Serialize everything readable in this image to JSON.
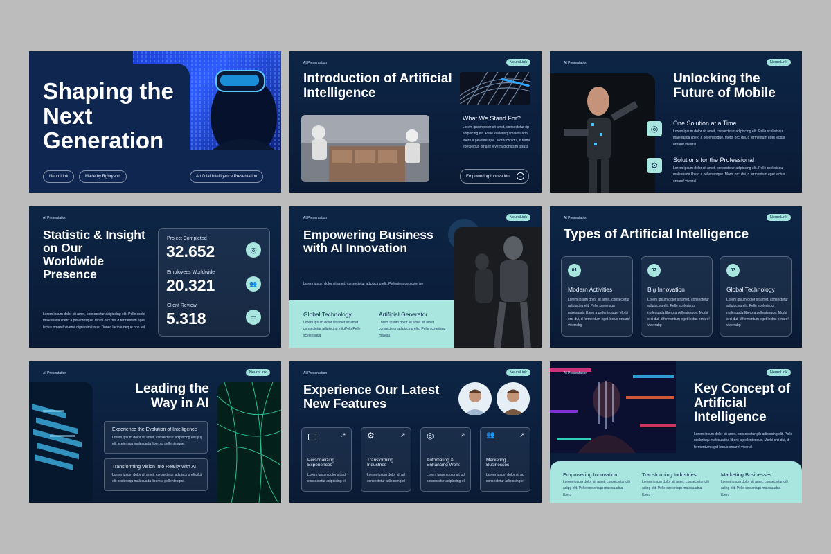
{
  "slides": {
    "s1": {
      "title": "Shaping the Next Generation",
      "pill_brand": "NeuroLink",
      "pill_author": "Made by Rgbryand",
      "pill_topic": "Artificial Intelligence Presentation"
    },
    "s2": {
      "tag": "AI Presentation",
      "brand": "NeuroLink",
      "title": "Introduction of Artificial Intelligence",
      "subheading": "What We Stand For?",
      "body": "Lorem ipsum dolor sit amet, consectetur rip adipiscing elit. Pelle scelerisqu malesuadn libero a pellentesque. Morbi orci dui, d fermi eget lectus ornare! viverra dignissim issusi",
      "button": "Empowering Innovation"
    },
    "s3": {
      "tag": "AI Presentation",
      "brand": "NeuroLink",
      "title": "Unlocking the Future of Mobile",
      "item1_title": "One Solution at a Time",
      "item1_body": "Lorem ipsum dolor sit amet, consectetur adipiscing elit. Pelle scelerisqu malesuada libero a pellentesque. Morbi orci dui, d fermentum eget lectus ornare! viverral",
      "item2_title": "Solutions for the Professional",
      "item2_body": "Lorem ipsum dolor sit amet, consectetur adipiscing elit. Pelle scelerisqu malesuada libero a pellentesque. Morbi orci dui, d fermentum eget lectus ornare! viverral"
    },
    "s4": {
      "tag": "AI Presentation",
      "title": "Statistic & Insight on Our Worldwide Presence",
      "body": "Lorem ipsum dolor sit amet, consectetur adipiscing elit. Pelle scele malesuada libero a pellentesque. Morbi orci dui, d fermentum eget lectus ornare! viverra dignissim issus. Donec lacinia neque non vel",
      "stat1_label": "Project Completed",
      "stat1_value": "32.652",
      "stat2_label": "Employees Worldwide",
      "stat2_value": "20.321",
      "stat3_label": "Client Review",
      "stat3_value": "5.318"
    },
    "s5": {
      "tag": "AI Presentation",
      "brand": "NeuroLink",
      "title": "Empowering Business with AI Innovation",
      "body": "Lorem ipsum dolor sit amet, consectetur adipiscing elit. Pellentesque scelerise",
      "col1_title": "Global Technology",
      "col1_body": "Lorem ipsum dolor sit amet sit amet consectetur adipiscing elitgPelp Pelle scelerisquai",
      "col2_title": "Artificial Generator",
      "col2_body": "Lorem ipsum dolor sit amet sit amet consectetur adipiscing elitg Pelle scelerisqu malesu"
    },
    "s6": {
      "tag": "AI Presentation",
      "brand": "NeuroLink",
      "title": "Types of Artificial Intelligence",
      "cards": [
        {
          "num": "01",
          "title": "Modern Activities",
          "body": "Lorem ipsum dolor sit amet, consectetur adipiscing elit. Pelle scelerisqu malesuada libero a pellentesque. Morbi orci dui, d fermentum eget lectus ornare! viverrabg"
        },
        {
          "num": "02",
          "title": "Big Innovation",
          "body": "Lorem ipsum dolor sit amet, consectetur adipiscing elit. Pelle scelerisqu malesuada libero a pellentesque. Morbi orci dui, d fermentum eget lectus ornare! viverrabg"
        },
        {
          "num": "03",
          "title": "Global Technology",
          "body": "Lorem ipsum dolor sit amet, consectetur adipiscing elit. Pelle scelerisqu malesuada libero a pellentesque. Morbi orci dui, d fermentum eget lectus ornare! viverrabg"
        }
      ]
    },
    "s7": {
      "tag": "AI Presentation",
      "brand": "NeuroLink",
      "title": "Leading the Way in AI",
      "box1_title": "Experience the Evolution of Intelligence",
      "box1_body": "Lorem ipsum dolor sit amet, consectetur adipiscing elitujkij elit scelerisqu malesuada libero a pellentesque.",
      "box2_title": "Transforming Vision into Reality with AI",
      "box2_body": "Lorem ipsum dolor sit amet, consectetur adipiscing elitujkij elit scelerisqu malesuada libero a pellentesque."
    },
    "s8": {
      "tag": "AI Presentation",
      "brand": "NeuroLink",
      "title": "Experience Our Latest New Features",
      "features": [
        {
          "title": "Personalizing Experiences",
          "body": "Lorem ipsum dolor sit ad consectetur adipiscing el"
        },
        {
          "title": "Transforming Industries",
          "body": "Lorem ipsum dolor sit ad consectetur adipiscing el"
        },
        {
          "title": "Automating & Enhancing Work",
          "body": "Lorem ipsum dolor sit ad consectetur adipiscing el"
        },
        {
          "title": "Marketing Businesses",
          "body": "Lorem ipsum dolor sit ad consectetur adipiscing el"
        }
      ]
    },
    "s9": {
      "tag": "AI Presentation",
      "brand": "NeuroLink",
      "title": "Key Concept of Artificial Intelligence",
      "body": "Lorem ipsum dolor sit amet, consectetur gib adipiscing elit. Pelle scelerisqu malesuadna libero a pellentesque. Morbi orci dui, d fermentum eget lectus ornare! viverral",
      "col1_title": "Empowering Innovation",
      "col1_body": "Lorem ipsum dolor sit amet, consectetur gifi adipg elit. Pelle scelerisqu malesuadna libero",
      "col2_title": "Transforming Industries",
      "col2_body": "Lorem ipsum dolor sit amet, consectetur gifi adipg elit. Pelle scelerisqu malesuadna libero",
      "col3_title": "Marketing Businesses",
      "col3_body": "Lorem ipsum dolor sit amet, consectetur gifi adipg elit. Pelle scelerisqu malesuadna libero"
    }
  },
  "colors": {
    "background": "#bcbcbc",
    "slide_navy": "#0b1f3c",
    "accent_mint": "#a9e6df",
    "text_light": "#c5d6ee"
  },
  "icons": [
    "target-icon",
    "gear-icon",
    "users-icon",
    "chat-icon",
    "arrow-right-icon",
    "arrow-up-right-icon"
  ]
}
